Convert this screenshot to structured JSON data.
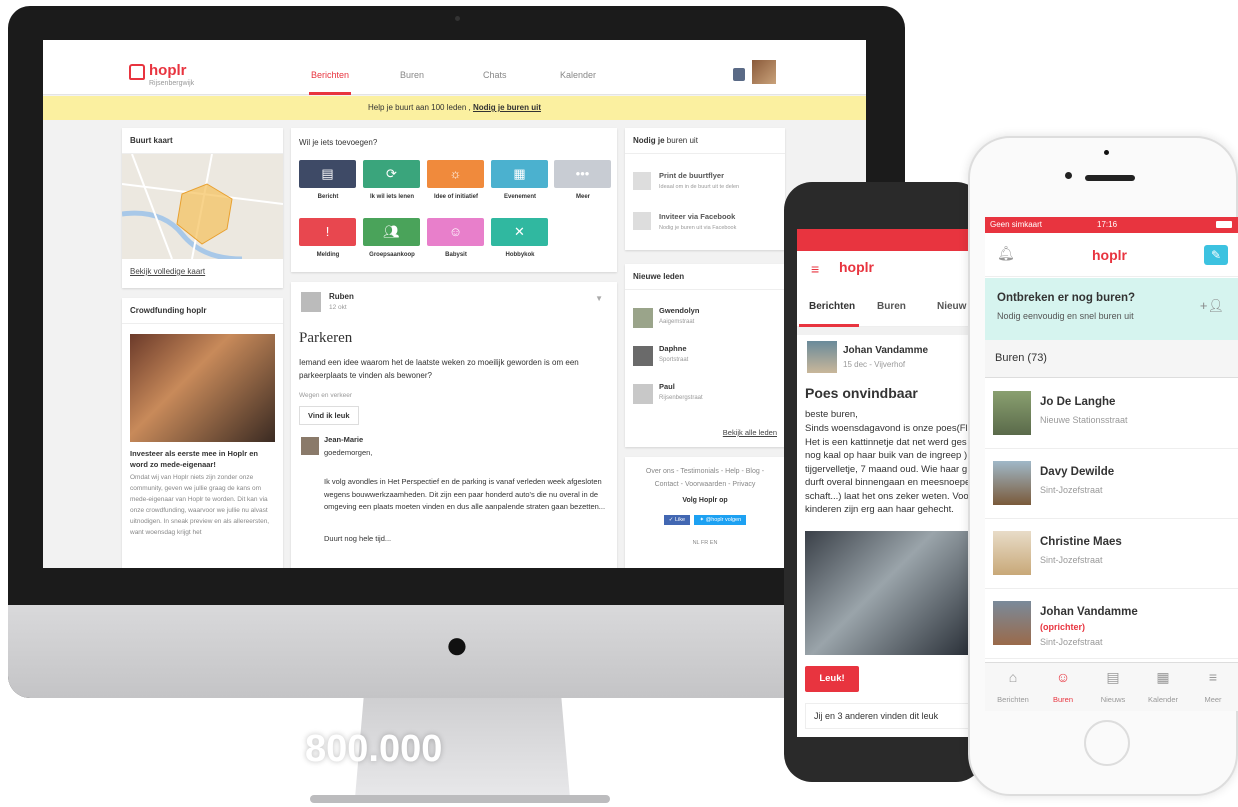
{
  "web": {
    "logo": "hoplr",
    "neighborhood": "Rijsenbergwijk",
    "nav": [
      "Berichten",
      "Buren",
      "Chats",
      "Kalender"
    ],
    "banner_text": "Help je buurt aan 100 leden ,",
    "banner_link": "Nodig je buren uit",
    "map_card": {
      "title": "Buurt kaart",
      "link": "Bekijk volledige kaart"
    },
    "crowd_card": {
      "title": "Crowdfunding hoplr",
      "headline": "Investeer als eerste mee in Hoplr en word zo mede-eigenaar!",
      "body": "Omdat wij van Hoplr niets zijn zonder onze community, geven we jullie graag de kans om mede-eigenaar van Hoplr te worden. Dit kan via onze crowdfunding, waarvoor we jullie nu alvast uitnodigen. In sneak preview en als allereersten, want woensdag krijgt het"
    },
    "add_card": {
      "title": "Wil je iets toevoegen?",
      "actions": [
        {
          "label": "Bericht",
          "icon": "message-icon",
          "color": "#3e4a66"
        },
        {
          "label": "Ik wil iets lenen",
          "icon": "refresh-icon",
          "color": "#3aa57c"
        },
        {
          "label": "Idee of initiatief",
          "icon": "lightbulb-icon",
          "color": "#f08a3c"
        },
        {
          "label": "Evenement",
          "icon": "calendar-icon",
          "color": "#4bb1cf"
        },
        {
          "label": "Meer",
          "icon": "more-icon",
          "color": "#c8ccd3"
        },
        {
          "label": "Melding",
          "icon": "alert-icon",
          "color": "#e8474f"
        },
        {
          "label": "Groepsaankoop",
          "icon": "group-icon",
          "color": "#4aa35a"
        },
        {
          "label": "Babysit",
          "icon": "baby-icon",
          "color": "#e87fcb"
        },
        {
          "label": "Hobbykok",
          "icon": "cutlery-icon",
          "color": "#30b8a0"
        }
      ]
    },
    "post": {
      "author": "Ruben",
      "date": "12 okt",
      "title": "Parkeren",
      "body": "Iemand een idee waarom het de laatste weken zo moeilijk geworden is om een parkeerplaats te vinden als bewoner?",
      "tag": "Wegen en verkeer",
      "like_button": "Vind ik leuk",
      "comment_author": "Jean-Marie",
      "comment_greeting": "goedemorgen,",
      "comment_body": "Ik volg avondles in Het Perspectief en de parking is vanaf verleden week afgesloten wegens bouwwerkzaamheden. Dit zijn een paar honderd auto's die nu overal in de omgeving een plaats moeten vinden en dus alle aanpalende straten gaan bezetten...",
      "comment_end": "Duurt nog hele tijd..."
    },
    "invite_card": {
      "title_bold": "Nodig je",
      "title_rest": "buren uit",
      "items": [
        {
          "title": "Print de buurtflyer",
          "sub": "Ideaal om in de buurt uit te delen"
        },
        {
          "title": "Inviteer via Facebook",
          "sub": "Nodig je buren uit via Facebook"
        }
      ]
    },
    "members_card": {
      "title": "Nieuwe leden",
      "members": [
        {
          "name": "Gwendolyn",
          "street": "Aaigemstraat"
        },
        {
          "name": "Daphne",
          "street": "Sportstraat"
        },
        {
          "name": "Paul",
          "street": "Rijsenbergstraat"
        }
      ],
      "link": "Bekijk alle leden"
    },
    "footer": {
      "links": "Over ons - Testimonials - Help - Blog - Contact - Voorwaarden - Privacy",
      "follow": "Volg Hoplr op",
      "like": "Like",
      "twitter": "@hoplr volgen",
      "langs": "NL  FR  EN"
    }
  },
  "android": {
    "logo": "hoplr",
    "tabs": [
      "Berichten",
      "Buren",
      "Nieuw"
    ],
    "post": {
      "author": "Johan Vandamme",
      "meta": "15 dec - Vijverhof",
      "title": "Poes onvindbaar",
      "greeting": "beste buren,",
      "body": "Sinds woensdagavond is onze poes(Fl Het is een kattinnetje dat net werd ges nog kaal op haar buik van de ingreep ) tijgervelletje, 7 maand oud. Wie haar g durft overal binnengaan en meesnoepe schaft...) laat het ons zeker weten. Voo kinderen zijn erg aan haar gehecht.",
      "like_button": "Leuk!",
      "likes_text": "Jij en 3 anderen vinden dit leuk"
    }
  },
  "iphone": {
    "carrier": "Geen simkaart",
    "time": "17:16",
    "logo": "hoplr",
    "prompt_title": "Ontbreken er nog buren?",
    "prompt_sub": "Nodig eenvoudig en snel buren uit",
    "section": "Buren (73)",
    "people": [
      {
        "name": "Jo De Langhe",
        "street": "Nieuwe Stationsstraat",
        "role": ""
      },
      {
        "name": "Davy Dewilde",
        "street": "Sint-Jozefstraat",
        "role": ""
      },
      {
        "name": "Christine Maes",
        "street": "Sint-Jozefstraat",
        "role": ""
      },
      {
        "name": "Johan Vandamme",
        "street": "Sint-Jozefstraat",
        "role": "(oprichter)"
      }
    ],
    "tabbar": [
      "Berichten",
      "Buren",
      "Nieuws",
      "Kalender",
      "Meer"
    ]
  },
  "stat": "800.000",
  "colors": {
    "brand": "#e8343f",
    "banner": "#fbf0a0",
    "invite_bg": "#d6f4ef"
  }
}
